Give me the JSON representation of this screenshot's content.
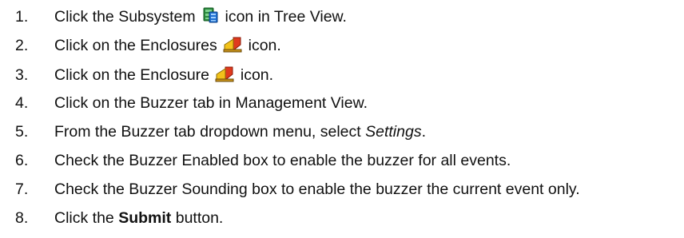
{
  "steps": [
    {
      "number": "1.",
      "pre": "Click the Subsystem",
      "icon": "subsystem-icon",
      "post": "icon in Tree View."
    },
    {
      "number": "2.",
      "pre": "Click on the Enclosures",
      "icon": "enclosure-icon",
      "post": "icon."
    },
    {
      "number": "3.",
      "pre": "Click on the Enclosure",
      "icon": "enclosure-icon",
      "post": "icon."
    },
    {
      "number": "4.",
      "text": "Click on the Buzzer tab in Management View."
    },
    {
      "number": "5.",
      "pre": "From the Buzzer tab dropdown menu, select",
      "emphasis": "Settings",
      "post": "."
    },
    {
      "number": "6.",
      "text": "Check the Buzzer Enabled box to enable the buzzer for all events."
    },
    {
      "number": "7.",
      "text": "Check the Buzzer Sounding box to enable the buzzer the current event only."
    },
    {
      "number": "8.",
      "pre": "Click the",
      "bold": "Submit",
      "post": "button."
    }
  ]
}
